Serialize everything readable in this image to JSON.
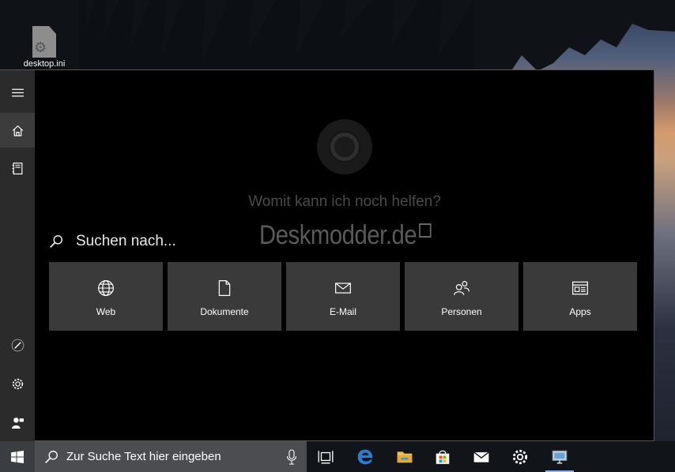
{
  "desktop": {
    "icon_label": "desktop.ini",
    "icon_name": "settings-file-icon"
  },
  "cortana": {
    "prompt": "Womit kann ich noch helfen?",
    "search_placeholder": "Suchen nach...",
    "watermark": "Deskmodder.de",
    "rail_items": [
      {
        "name": "menu-icon"
      },
      {
        "name": "home-icon"
      },
      {
        "name": "notebook-icon"
      },
      {
        "name": "pen-icon"
      },
      {
        "name": "gear-icon"
      },
      {
        "name": "feedback-icon"
      }
    ],
    "tiles": [
      {
        "label": "Web",
        "icon": "globe-icon"
      },
      {
        "label": "Dokumente",
        "icon": "document-icon"
      },
      {
        "label": "E-Mail",
        "icon": "mail-icon"
      },
      {
        "label": "Personen",
        "icon": "people-icon"
      },
      {
        "label": "Apps",
        "icon": "apps-icon"
      }
    ]
  },
  "taskbar": {
    "search_placeholder": "Zur Suche Text hier eingeben",
    "pinned": [
      {
        "name": "task-view-icon"
      },
      {
        "name": "edge-icon"
      },
      {
        "name": "file-explorer-icon"
      },
      {
        "name": "store-icon"
      },
      {
        "name": "mail-app-icon"
      },
      {
        "name": "settings-icon"
      },
      {
        "name": "remote-desktop-icon"
      }
    ],
    "colors": {
      "accent": "#3a8ee6",
      "edge": "#2b7cd3",
      "folder": "#f0c24a"
    }
  }
}
